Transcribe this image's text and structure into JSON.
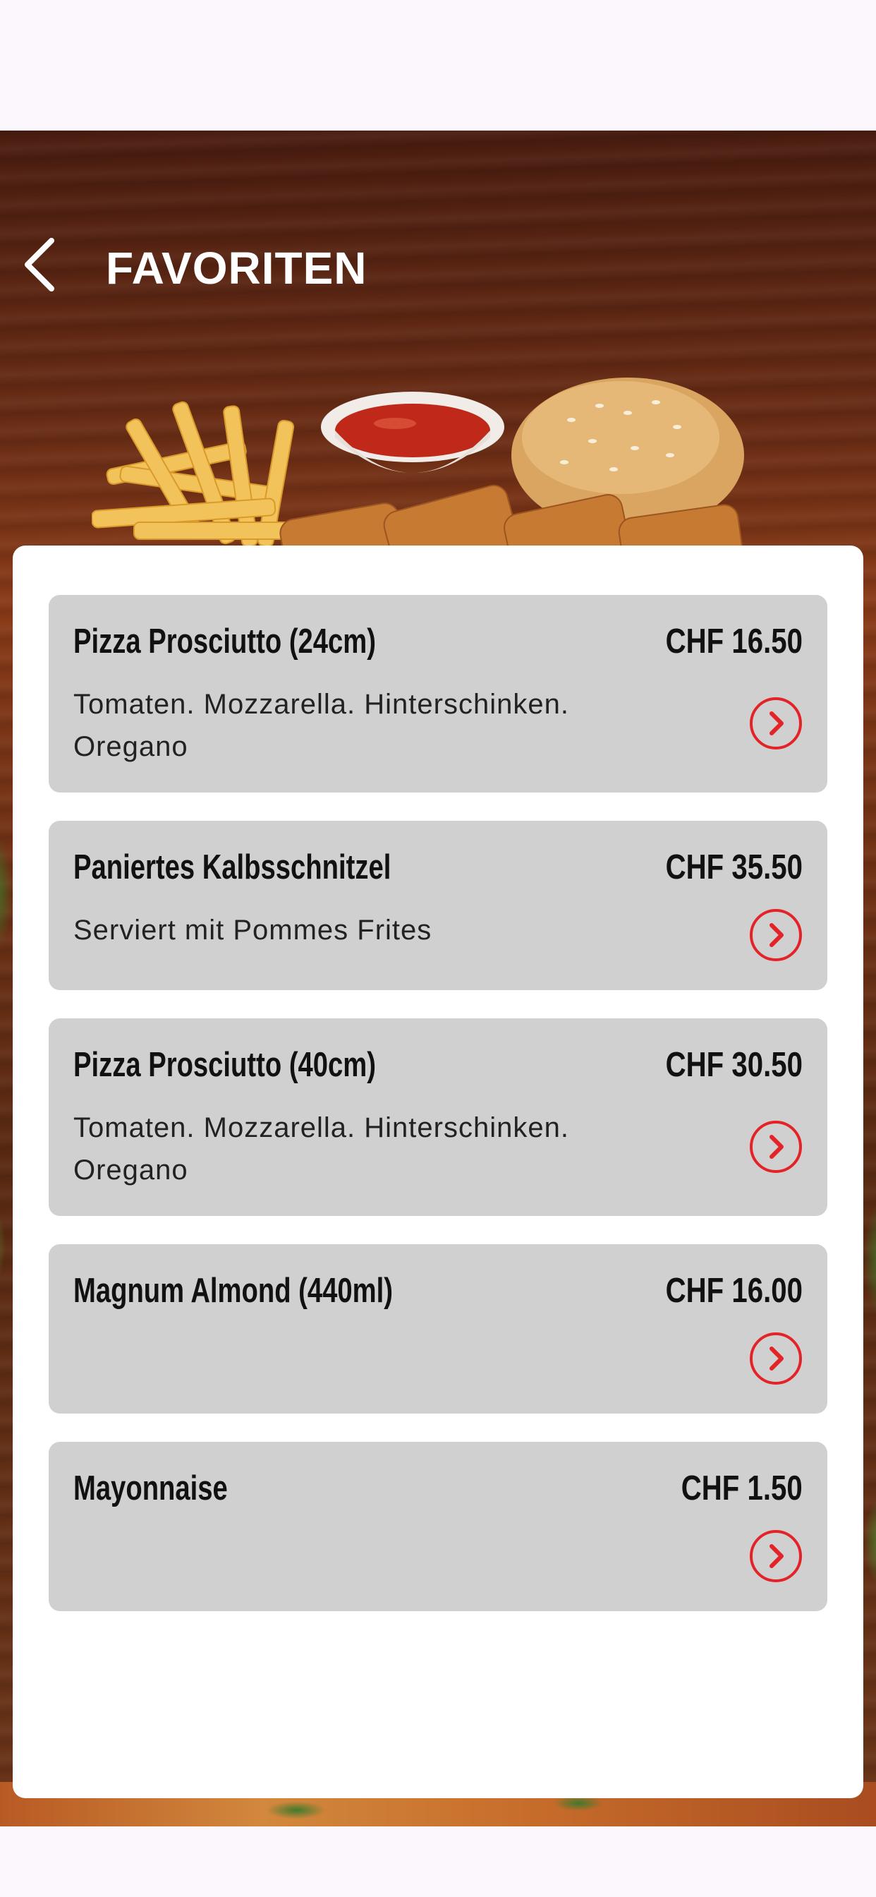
{
  "header": {
    "title": "FAVORITEN",
    "back_icon": "chevron-left-icon"
  },
  "colors": {
    "accent": "#e42328",
    "card_bg": "#d0d0d0",
    "panel_bg": "#ffffff",
    "page_bg": "#fcf7fd"
  },
  "favorites": [
    {
      "name": "Pizza Prosciutto (24cm)",
      "price": "CHF 16.50",
      "description": "Tomaten. Mozzarella. Hinterschinken. Oregano"
    },
    {
      "name": "Paniertes Kalbsschnitzel",
      "price": "CHF 35.50",
      "description": "Serviert mit Pommes Frites"
    },
    {
      "name": "Pizza Prosciutto (40cm)",
      "price": "CHF 30.50",
      "description": "Tomaten. Mozzarella. Hinterschinken. Oregano"
    },
    {
      "name": "Magnum Almond (440ml)",
      "price": "CHF 16.00",
      "description": ""
    },
    {
      "name": "Mayonnaise",
      "price": "CHF 1.50",
      "description": ""
    }
  ]
}
